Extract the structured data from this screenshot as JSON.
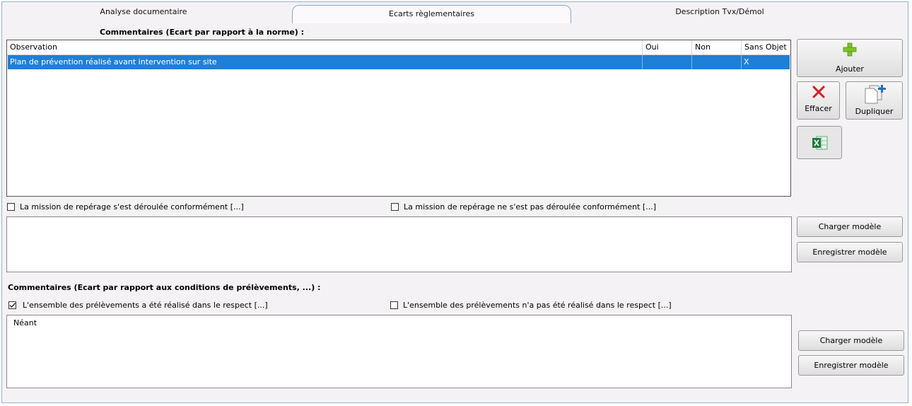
{
  "tabs": [
    {
      "label": "Analyse documentaire"
    },
    {
      "label": "Ecarts règlementaires"
    },
    {
      "label": "Description Tvx/Démol"
    }
  ],
  "section1": {
    "title": "Commentaires (Ecart par rapport à la norme) :",
    "columns": [
      "Observation",
      "Oui",
      "Non",
      "Sans Objet"
    ],
    "rows": [
      {
        "observation": "Plan de prévention réalisé avant intervention sur site",
        "oui": "",
        "non": "",
        "sans_objet": "X"
      }
    ]
  },
  "buttons": {
    "ajouter": "Ajouter",
    "effacer": "Effacer",
    "dupliquer": "Dupliquer",
    "charger_modele": "Charger modèle",
    "enregistrer_modele": "Enregistrer modèle"
  },
  "mission": {
    "option1": "La mission de repérage s'est déroulée conformément [...]",
    "option2": "La mission de repérage ne s'est pas déroulée conformément [...]",
    "option1_checked": false,
    "option2_checked": false,
    "text": ""
  },
  "section2": {
    "title": "Commentaires (Ecart par rapport aux conditions de prélèvements, ...) :",
    "option1": "L'ensemble des prélèvements a été réalisé dans le respect [...]",
    "option2": "L'ensemble des prélèvements n'a pas été réalisé dans le respect [...]",
    "option1_checked": true,
    "option2_checked": false,
    "text": "Néant"
  },
  "colors": {
    "selection": "#1f7fd6",
    "add_icon": "#7cc42a",
    "delete_icon": "#d42020",
    "duplicate_icon": "#1f6fc9",
    "excel_icon": "#1e7a3c"
  }
}
